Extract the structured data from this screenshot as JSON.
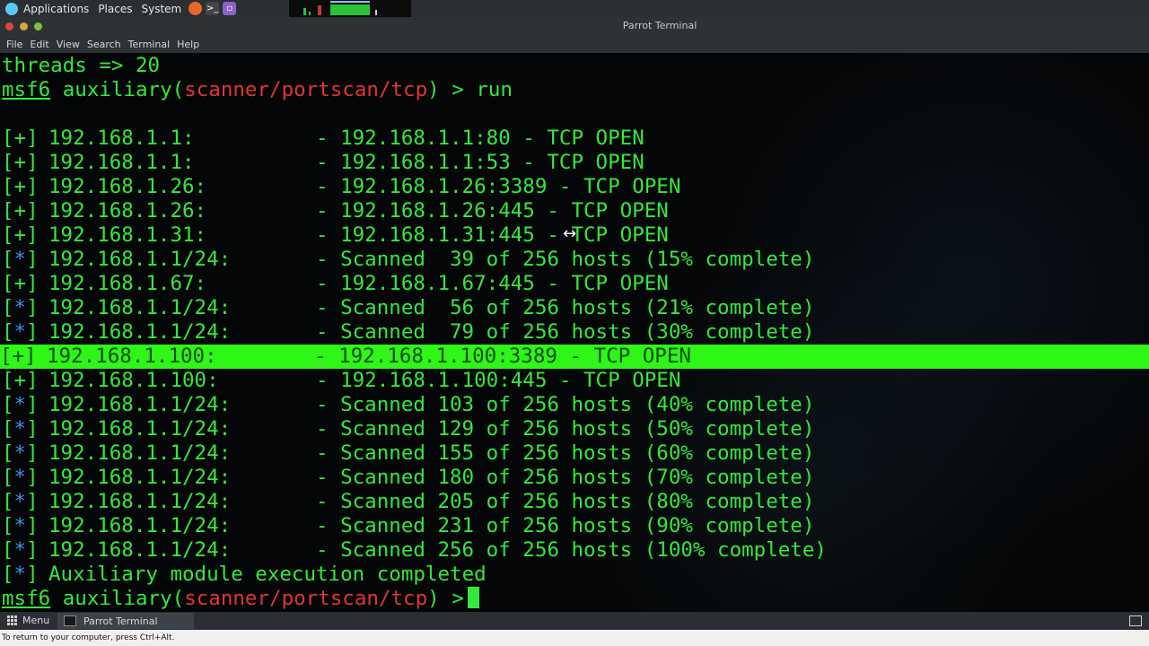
{
  "top_panel": {
    "menus": [
      "Applications",
      "Places",
      "System"
    ]
  },
  "window": {
    "title": "Parrot Terminal",
    "menu": [
      "File",
      "Edit",
      "View",
      "Search",
      "Terminal",
      "Help"
    ]
  },
  "terminal": {
    "threads_line": "threads => 20",
    "prompt": {
      "msf": "msf6",
      "word": "auxiliary",
      "module": "scanner/portscan/tcp",
      "command": " > run"
    },
    "results": [
      {
        "tag": "+",
        "host": "192.168.1.1:",
        "text": "- 192.168.1.1:80 - TCP OPEN"
      },
      {
        "tag": "+",
        "host": "192.168.1.1:",
        "text": "- 192.168.1.1:53 - TCP OPEN"
      },
      {
        "tag": "+",
        "host": "192.168.1.26:",
        "text": "- 192.168.1.26:3389 - TCP OPEN"
      },
      {
        "tag": "+",
        "host": "192.168.1.26:",
        "text": "- 192.168.1.26:445 - TCP OPEN"
      },
      {
        "tag": "+",
        "host": "192.168.1.31:",
        "text": "- 192.168.1.31:445 - TCP OPEN"
      },
      {
        "tag": "*",
        "host": "192.168.1.1/24:",
        "text": "- Scanned  39 of 256 hosts (15% complete)"
      },
      {
        "tag": "+",
        "host": "192.168.1.67:",
        "text": "- 192.168.1.67:445 - TCP OPEN"
      },
      {
        "tag": "*",
        "host": "192.168.1.1/24:",
        "text": "- Scanned  56 of 256 hosts (21% complete)"
      },
      {
        "tag": "*",
        "host": "192.168.1.1/24:",
        "text": "- Scanned  79 of 256 hosts (30% complete)"
      },
      {
        "tag": "+",
        "host": "192.168.1.100:",
        "text": "- 192.168.1.100:3389 - TCP OPEN"
      },
      {
        "tag": "+",
        "host": "192.168.1.100:",
        "text": "- 192.168.1.100:445 - TCP OPEN"
      },
      {
        "tag": "*",
        "host": "192.168.1.1/24:",
        "text": "- Scanned 103 of 256 hosts (40% complete)"
      },
      {
        "tag": "*",
        "host": "192.168.1.1/24:",
        "text": "- Scanned 129 of 256 hosts (50% complete)"
      },
      {
        "tag": "*",
        "host": "192.168.1.1/24:",
        "text": "- Scanned 155 of 256 hosts (60% complete)"
      },
      {
        "tag": "*",
        "host": "192.168.1.1/24:",
        "text": "- Scanned 180 of 256 hosts (70% complete)"
      },
      {
        "tag": "*",
        "host": "192.168.1.1/24:",
        "text": "- Scanned 205 of 256 hosts (80% complete)"
      },
      {
        "tag": "*",
        "host": "192.168.1.1/24:",
        "text": "- Scanned 231 of 256 hosts (90% complete)"
      },
      {
        "tag": "*",
        "host": "192.168.1.1/24:",
        "text": "- Scanned 256 of 256 hosts (100% complete)"
      }
    ],
    "highlighted_result_index": 9,
    "completion": {
      "tag": "*",
      "text": "Auxiliary module execution completed"
    },
    "final_prompt": {
      "msf": "msf6",
      "word": "auxiliary",
      "module": "scanner/portscan/tcp",
      "symbol": " >"
    }
  },
  "taskbar": {
    "menu_label": "Menu",
    "task_label": "Parrot Terminal"
  },
  "status_text": "To return to your computer, press Ctrl+Alt.",
  "colors": {
    "terminal_green": "#35e83c",
    "info_blue": "#3f8ee8",
    "module_red": "#e03535",
    "highlight": "#2ef617"
  }
}
